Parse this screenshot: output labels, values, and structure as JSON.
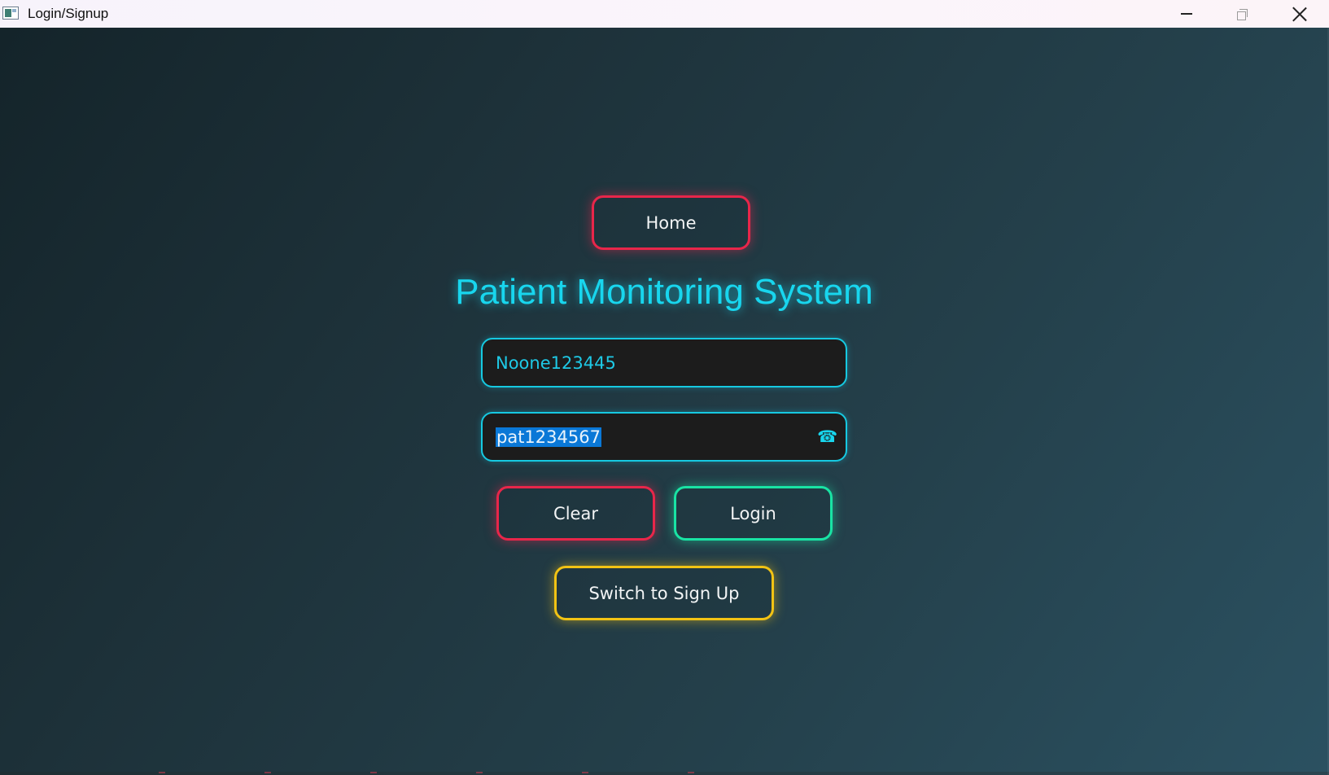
{
  "window": {
    "title": "Login/Signup"
  },
  "home_button": {
    "label": "Home"
  },
  "title": "Patient Monitoring System",
  "username_field": {
    "value": "Noone123445"
  },
  "password_field": {
    "value": "pat1234567",
    "selected": true,
    "icon": "phone-icon"
  },
  "actions": {
    "clear_label": "Clear",
    "login_label": "Login",
    "switch_label": "Switch to Sign Up"
  },
  "colors": {
    "accent_cyan": "#18d6ee",
    "danger_red": "#e8264a",
    "success_green": "#19e3a4",
    "warning_yellow": "#f2c314",
    "field_bg": "#1c1c1c",
    "selection_blue": "#0a78d7"
  }
}
